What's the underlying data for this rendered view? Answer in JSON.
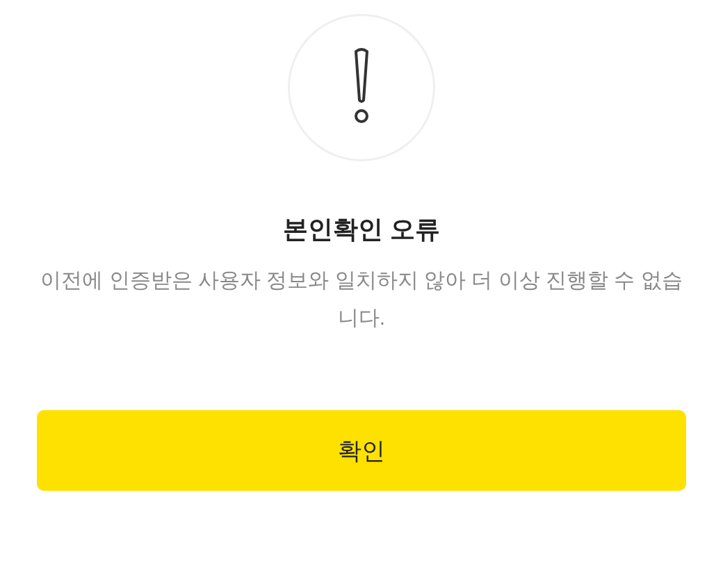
{
  "dialog": {
    "title": "본인확인 오류",
    "message": "이전에 인증받은 사용자 정보와 일치하지 않아 더 이상 진행할 수 없습니다.",
    "button": "확인"
  }
}
